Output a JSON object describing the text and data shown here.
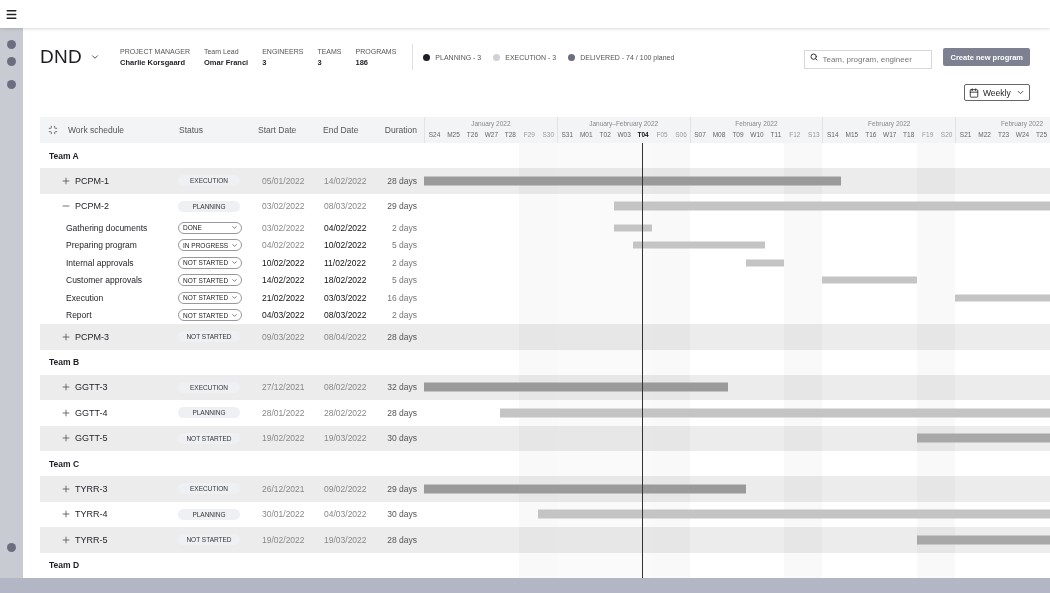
{
  "header": {
    "title": "DND",
    "meta": [
      {
        "label": "PROJECT MANAGER",
        "value": "Charlie Korsgaard"
      },
      {
        "label": "Team Lead",
        "value": "Omar Franci"
      },
      {
        "label": "ENGINEERS",
        "value": "3"
      },
      {
        "label": "TEAMS",
        "value": "3"
      },
      {
        "label": "PROGRAMS",
        "value": "186"
      }
    ],
    "legend": [
      {
        "label": "PLANNING - 3",
        "color": "#1e1f26"
      },
      {
        "label": "EXECUTION - 3",
        "color": "#cfd1d6"
      },
      {
        "label": "DELIVERED - 74 / 100 planed",
        "color": "#6b6e80"
      }
    ],
    "search": {
      "placeholder": "Team, program, engineer"
    },
    "create_button": "Create new program",
    "view_select": "Weekly"
  },
  "table": {
    "columns": [
      "Work schedule",
      "Status",
      "Start Date",
      "End Date",
      "Duration"
    ],
    "weeks": [
      {
        "label": "January 2022",
        "days": [
          {
            "label": "S24",
            "weekend": false,
            "today": false
          },
          {
            "label": "M25",
            "weekend": false,
            "today": false
          },
          {
            "label": "T26",
            "weekend": false,
            "today": false
          },
          {
            "label": "W27",
            "weekend": false,
            "today": false
          },
          {
            "label": "T28",
            "weekend": false,
            "today": false
          },
          {
            "label": "F29",
            "weekend": true,
            "today": false
          },
          {
            "label": "S30",
            "weekend": true,
            "today": false
          }
        ]
      },
      {
        "label": "January–February 2022",
        "days": [
          {
            "label": "S31",
            "weekend": false,
            "today": false
          },
          {
            "label": "M01",
            "weekend": false,
            "today": false
          },
          {
            "label": "T02",
            "weekend": false,
            "today": false
          },
          {
            "label": "W03",
            "weekend": false,
            "today": false
          },
          {
            "label": "T04",
            "weekend": false,
            "today": true
          },
          {
            "label": "F05",
            "weekend": true,
            "today": false
          },
          {
            "label": "S06",
            "weekend": true,
            "today": false
          }
        ]
      },
      {
        "label": "February 2022",
        "days": [
          {
            "label": "S07",
            "weekend": false,
            "today": false
          },
          {
            "label": "M08",
            "weekend": false,
            "today": false
          },
          {
            "label": "T09",
            "weekend": false,
            "today": false
          },
          {
            "label": "W10",
            "weekend": false,
            "today": false
          },
          {
            "label": "T11",
            "weekend": false,
            "today": false
          },
          {
            "label": "F12",
            "weekend": true,
            "today": false
          },
          {
            "label": "S13",
            "weekend": true,
            "today": false
          }
        ]
      },
      {
        "label": "February 2022",
        "days": [
          {
            "label": "S14",
            "weekend": false,
            "today": false
          },
          {
            "label": "M15",
            "weekend": false,
            "today": false
          },
          {
            "label": "T16",
            "weekend": false,
            "today": false
          },
          {
            "label": "W17",
            "weekend": false,
            "today": false
          },
          {
            "label": "T18",
            "weekend": false,
            "today": false
          },
          {
            "label": "F19",
            "weekend": true,
            "today": false
          },
          {
            "label": "S20",
            "weekend": true,
            "today": false
          }
        ]
      },
      {
        "label": "February 2022",
        "days": [
          {
            "label": "S21",
            "weekend": false,
            "today": false
          },
          {
            "label": "M22",
            "weekend": false,
            "today": false
          },
          {
            "label": "T23",
            "weekend": false,
            "today": false
          },
          {
            "label": "W24",
            "weekend": false,
            "today": false
          },
          {
            "label": "T25",
            "weekend": false,
            "today": false
          }
        ]
      }
    ],
    "rows": [
      {
        "kind": "team",
        "name": "Team A"
      },
      {
        "kind": "program",
        "name": "PCPM-1",
        "expanded": false,
        "status": "EXECUTION",
        "color": "#9a9a9a",
        "start": "05/01/2022",
        "end": "14/02/2022",
        "duration": "28 days"
      },
      {
        "kind": "program",
        "name": "PCPM-2",
        "expanded": true,
        "status": "PLANNING",
        "color": "#c4c4c4",
        "start": "03/02/2022",
        "end": "08/03/2022",
        "duration": "29 days"
      },
      {
        "kind": "task",
        "name": "Gathering documents",
        "status": "DONE",
        "start": {
          "text": "03/02/2022",
          "muted": true
        },
        "end": {
          "text": "04/02/2022",
          "muted": false
        },
        "duration": "2 days"
      },
      {
        "kind": "task",
        "name": "Preparing program",
        "status": "IN PROGRESS",
        "start": {
          "text": "04/02/2022",
          "muted": true
        },
        "end": {
          "text": "10/02/2022",
          "muted": false
        },
        "duration": "5 days"
      },
      {
        "kind": "task",
        "name": "Internal approvals",
        "status": "NOT STARTED",
        "start": {
          "text": "10/02/2022",
          "muted": false
        },
        "end": {
          "text": "11/02/2022",
          "muted": false
        },
        "duration": "2 days"
      },
      {
        "kind": "task",
        "name": "Customer approvals",
        "status": "NOT STARTED",
        "start": {
          "text": "14/02/2022",
          "muted": false
        },
        "end": {
          "text": "18/02/2022",
          "muted": false
        },
        "duration": "5 days"
      },
      {
        "kind": "task",
        "name": "Execution",
        "status": "NOT STARTED",
        "start": {
          "text": "21/02/2022",
          "muted": false
        },
        "end": {
          "text": "03/03/2022",
          "muted": false
        },
        "duration": "16 days"
      },
      {
        "kind": "task",
        "name": "Report",
        "status": "NOT STARTED",
        "start": {
          "text": "04/03/2022",
          "muted": false
        },
        "end": {
          "text": "08/03/2022",
          "muted": false
        },
        "duration": "2 days"
      },
      {
        "kind": "program",
        "name": "PCPM-3",
        "expanded": false,
        "status": "NOT STARTED",
        "start": "09/03/2022",
        "end": "08/04/2022",
        "duration": "28 days"
      },
      {
        "kind": "team",
        "name": "Team B"
      },
      {
        "kind": "program",
        "name": "GGTT-3",
        "expanded": false,
        "status": "EXECUTION",
        "color": "#9a9a9a",
        "start": "27/12/2021",
        "end": "08/02/2022",
        "duration": "32 days"
      },
      {
        "kind": "program",
        "name": "GGTT-4",
        "expanded": false,
        "status": "PLANNING",
        "color": "#c4c4c4",
        "start": "28/01/2022",
        "end": "28/02/2022",
        "duration": "28 days"
      },
      {
        "kind": "program",
        "name": "GGTT-5",
        "expanded": false,
        "status": "NOT STARTED",
        "color": "#a8a8a8",
        "start": "19/02/2022",
        "end": "19/03/2022",
        "duration": "30 days"
      },
      {
        "kind": "team",
        "name": "Team C"
      },
      {
        "kind": "program",
        "name": "TYRR-3",
        "expanded": false,
        "status": "EXECUTION",
        "color": "#9a9a9a",
        "start": "26/12/2021",
        "end": "09/02/2022",
        "duration": "29 days"
      },
      {
        "kind": "program",
        "name": "TYRR-4",
        "expanded": false,
        "status": "PLANNING",
        "color": "#c4c4c4",
        "start": "30/01/2022",
        "end": "04/03/2022",
        "duration": "30 days"
      },
      {
        "kind": "program",
        "name": "TYRR-5",
        "expanded": false,
        "status": "NOT STARTED",
        "color": "#a8a8a8",
        "start": "19/02/2022",
        "end": "19/03/2022",
        "duration": "28 days"
      },
      {
        "kind": "team",
        "name": "Team D"
      }
    ]
  }
}
